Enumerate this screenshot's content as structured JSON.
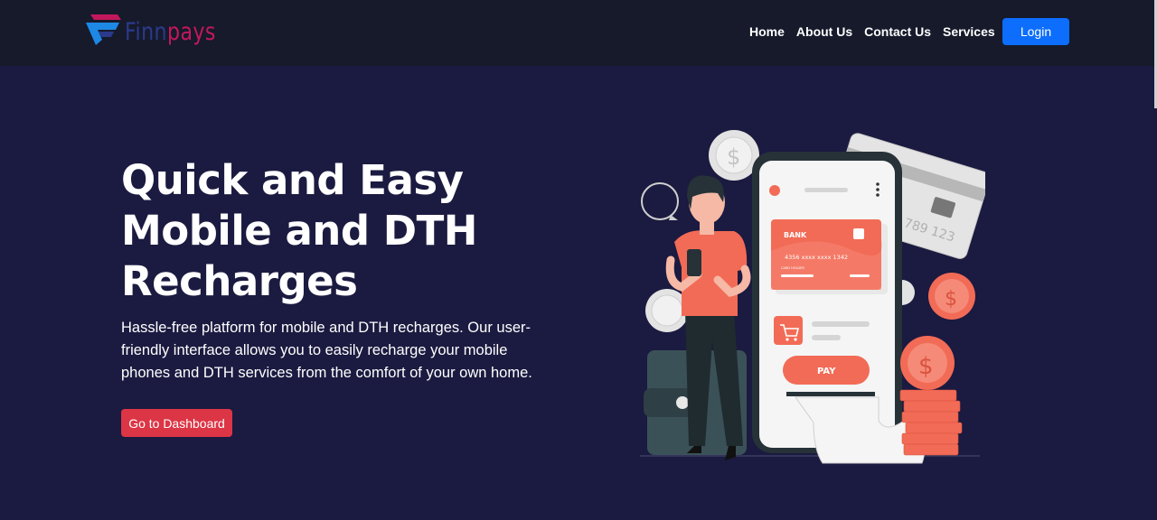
{
  "brand": {
    "name_part1": "Finn",
    "name_part2": "pays"
  },
  "nav": {
    "links": [
      {
        "label": "Home"
      },
      {
        "label": "About Us"
      },
      {
        "label": "Contact Us"
      },
      {
        "label": "Services"
      }
    ],
    "login_label": "Login"
  },
  "hero": {
    "title": "Quick and Easy Mobile and DTH Recharges",
    "description": "Hassle-free platform for mobile and DTH recharges. Our user-friendly interface allows you to easily recharge your mobile phones and DTH services from the comfort of your own home.",
    "cta_label": "Go to Dashboard"
  },
  "illustration": {
    "card_brand": "BANK",
    "card_number": "4356  xxxx  xxxx  1342",
    "card_holder": "CARD HOLDER",
    "back_card_number": "789 123",
    "pay_label": "PAY",
    "coin_symbol": "$"
  },
  "colors": {
    "background": "#1b1a40",
    "navbar": "#161a2b",
    "accent_blue": "#0d6efd",
    "accent_red": "#dc3545",
    "illustration_coral": "#f26b56",
    "logo_blue": "#2b3a8c",
    "logo_pink": "#c2185b"
  }
}
